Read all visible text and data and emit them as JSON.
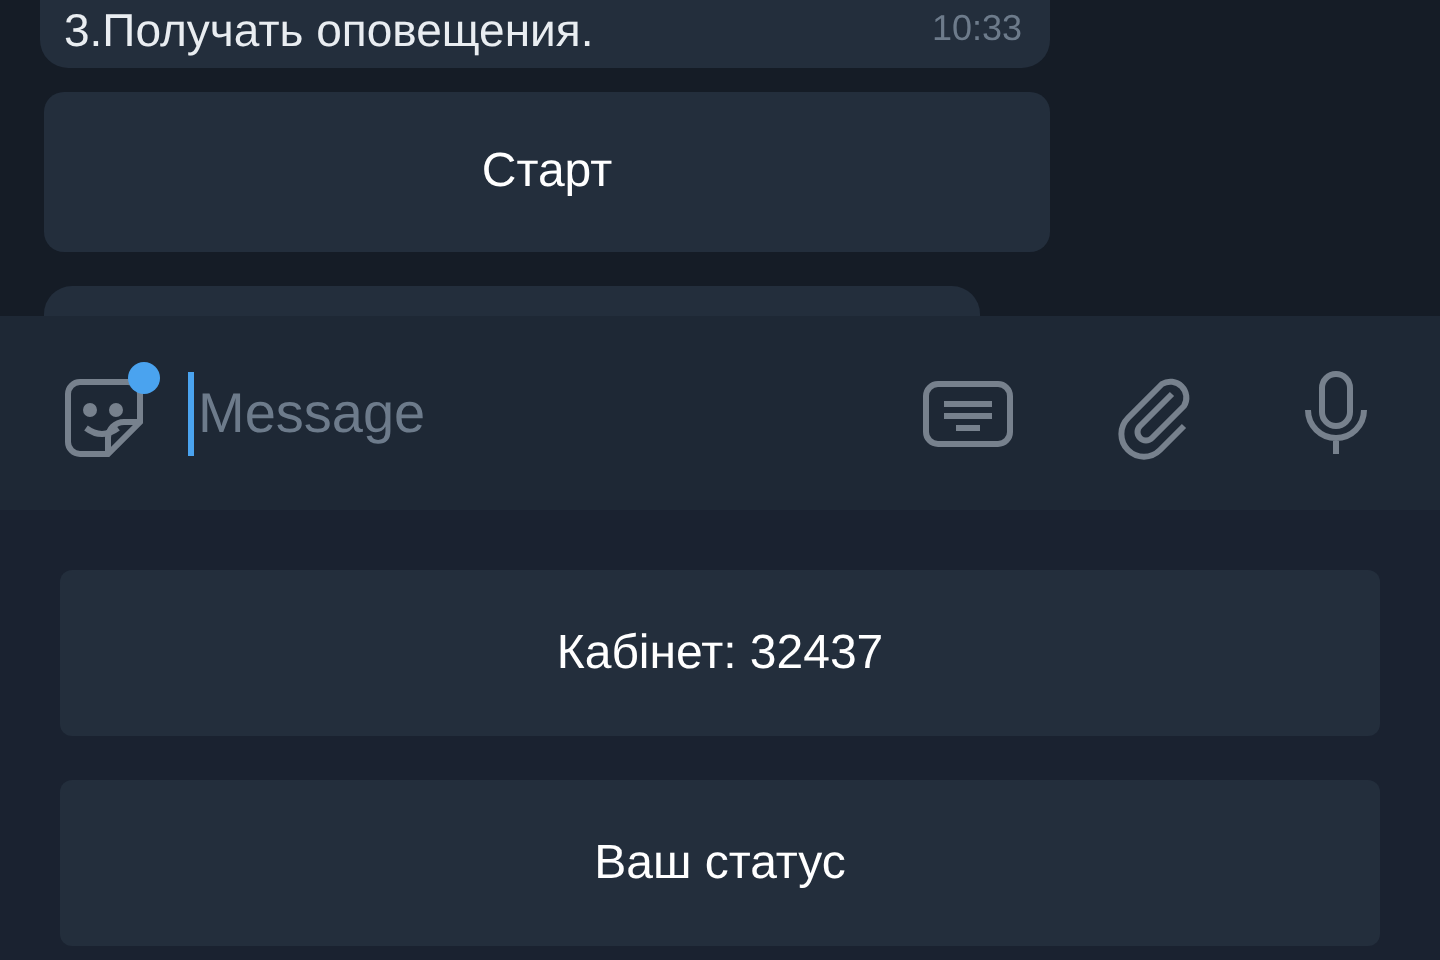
{
  "message": {
    "text": "3.Получать оповещения.",
    "time": "10:33"
  },
  "inline_buttons": [
    {
      "label": "Старт"
    }
  ],
  "composer": {
    "placeholder": "Message",
    "sticker_badge": true
  },
  "keyboard_buttons": [
    {
      "label": "Кабінет: 32437"
    },
    {
      "label": "Ваш статус"
    }
  ]
}
